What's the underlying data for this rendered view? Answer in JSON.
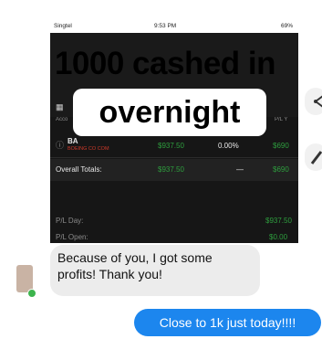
{
  "phone_status": {
    "carrier": "Singtel",
    "time": "9:53 PM",
    "battery": "69%"
  },
  "meme": {
    "line1": "1000 cashed in",
    "line2": "overnight"
  },
  "table": {
    "account_label": "Acco",
    "col_label": "P/L Y",
    "ba_symbol": "BA",
    "ba_name": "BOEING CO COM",
    "ba_value": "$937.50",
    "ba_pct": "0.00%",
    "ba_last": "$690",
    "overall_label": "Overall Totals:",
    "overall_value": "$937.50",
    "overall_dash": "—",
    "overall_last": "$690",
    "pl_day_label": "P/L Day:",
    "pl_day_value": "$937.50",
    "pl_open_label": "P/L Open:",
    "pl_open_value": "$0.00"
  },
  "messages": {
    "incoming": "Because of you, I got some profits! Thank you!",
    "outgoing": "Close to 1k just today!!!!"
  }
}
